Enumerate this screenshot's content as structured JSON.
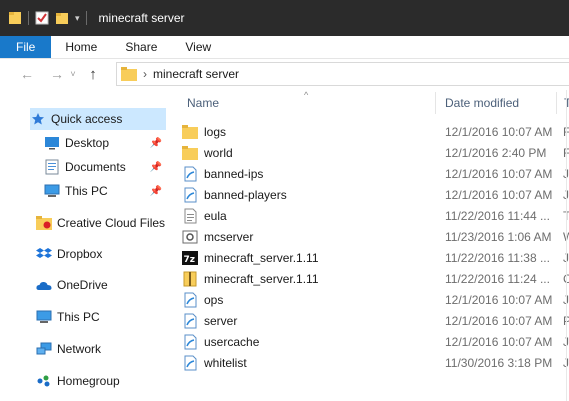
{
  "window": {
    "title": "minecraft server"
  },
  "ribbon": {
    "tabs": [
      "File",
      "Home",
      "Share",
      "View"
    ]
  },
  "address": {
    "path": "minecraft server"
  },
  "nav": {
    "items": [
      {
        "label": "Quick access",
        "icon": "star-icon"
      },
      {
        "label": "Desktop",
        "icon": "desktop-icon"
      },
      {
        "label": "Documents",
        "icon": "documents-icon"
      },
      {
        "label": "This PC",
        "icon": "this-pc-icon"
      },
      {
        "label": "Creative Cloud Files",
        "icon": "creative-cloud-icon"
      },
      {
        "label": "Dropbox",
        "icon": "dropbox-icon"
      },
      {
        "label": "OneDrive",
        "icon": "onedrive-icon"
      },
      {
        "label": "This PC",
        "icon": "this-pc-icon"
      },
      {
        "label": "Network",
        "icon": "network-icon"
      },
      {
        "label": "Homegroup",
        "icon": "homegroup-icon"
      }
    ]
  },
  "columns": {
    "name": "Name",
    "date": "Date modified",
    "type": "T"
  },
  "files": [
    {
      "name": "logs",
      "date": "12/1/2016 10:07 AM",
      "type": "F",
      "icon": "folder-icon"
    },
    {
      "name": "world",
      "date": "12/1/2016 2:40 PM",
      "type": "F",
      "icon": "folder-icon"
    },
    {
      "name": "banned-ips",
      "date": "12/1/2016 10:07 AM",
      "type": "J",
      "icon": "json-file-icon"
    },
    {
      "name": "banned-players",
      "date": "12/1/2016 10:07 AM",
      "type": "J",
      "icon": "json-file-icon"
    },
    {
      "name": "eula",
      "date": "11/22/2016 11:44 ...",
      "type": "T",
      "icon": "text-file-icon"
    },
    {
      "name": "mcserver",
      "date": "11/23/2016 1:06 AM",
      "type": "W",
      "icon": "batch-file-icon"
    },
    {
      "name": "minecraft_server.1.11",
      "date": "11/22/2016 11:38 ...",
      "type": "J",
      "icon": "7zip-archive-icon"
    },
    {
      "name": "minecraft_server.1.11",
      "date": "11/22/2016 11:24 ...",
      "type": "C",
      "icon": "zip-archive-icon"
    },
    {
      "name": "ops",
      "date": "12/1/2016 10:07 AM",
      "type": "J",
      "icon": "json-file-icon"
    },
    {
      "name": "server",
      "date": "12/1/2016 10:07 AM",
      "type": "P",
      "icon": "json-file-icon"
    },
    {
      "name": "usercache",
      "date": "12/1/2016 10:07 AM",
      "type": "J",
      "icon": "json-file-icon"
    },
    {
      "name": "whitelist",
      "date": "11/30/2016 3:18 PM",
      "type": "J",
      "icon": "json-file-icon"
    }
  ],
  "colors": {
    "accent": "#1979ca",
    "titlebar": "#2b2b2b",
    "folder": "#f8cd5a",
    "selected": "#cce8ff"
  }
}
